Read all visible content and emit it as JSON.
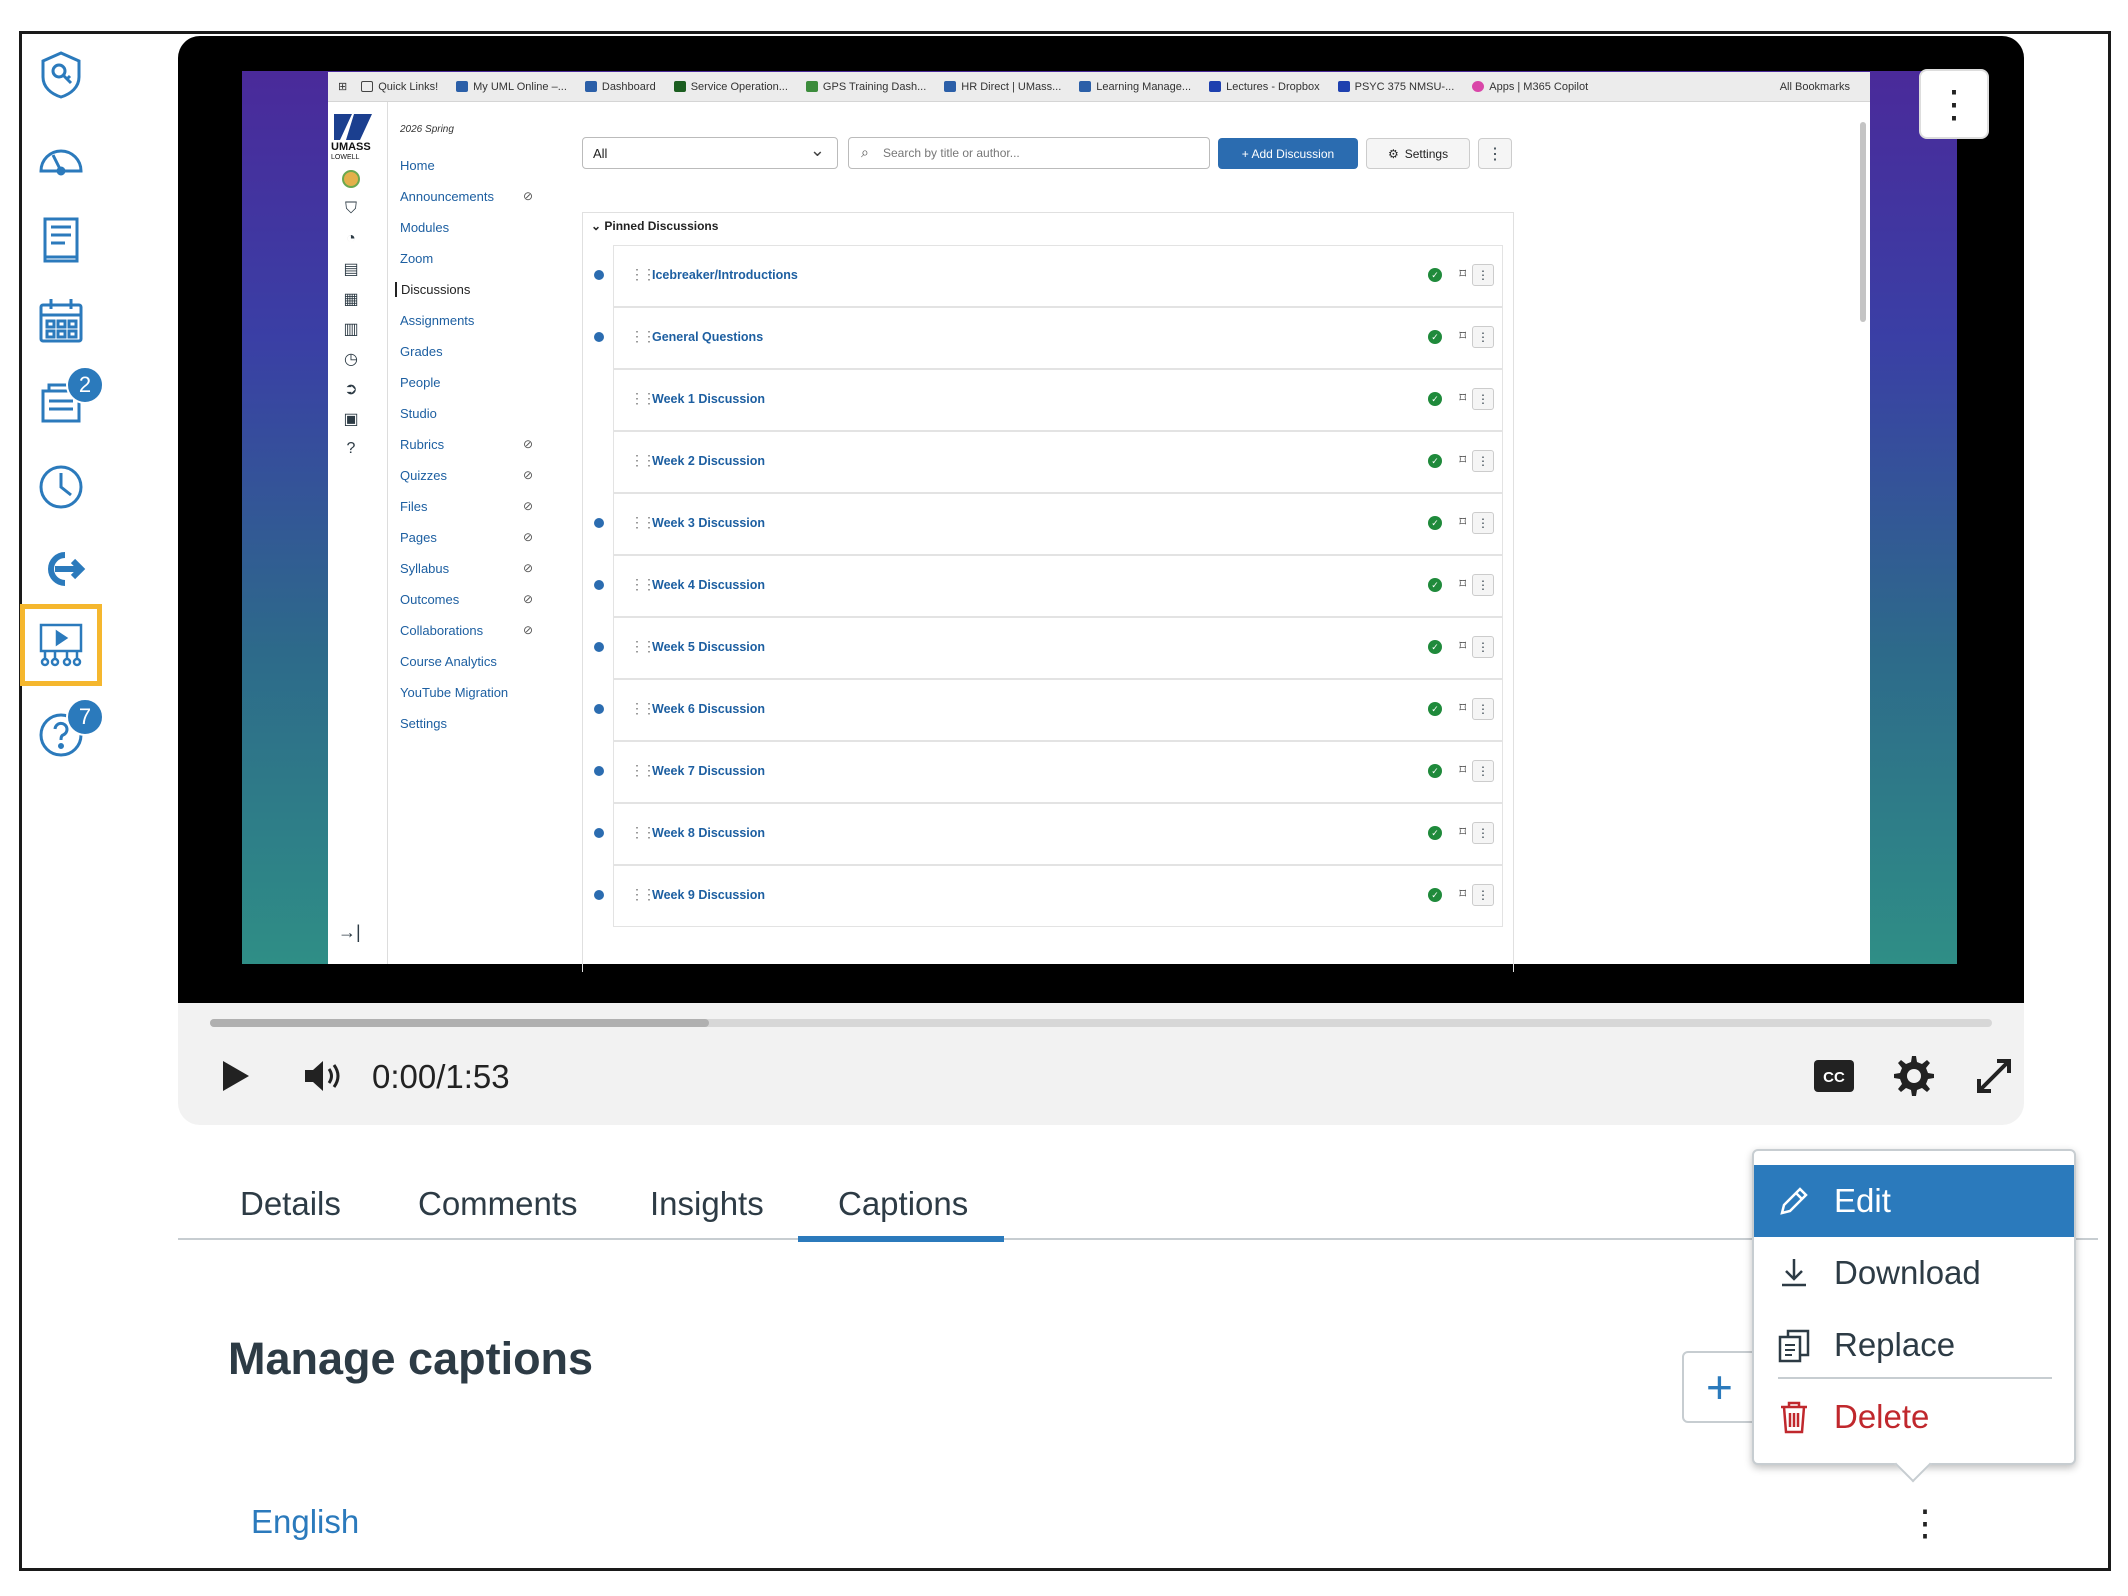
{
  "rail": {
    "badges": {
      "inbox": "2",
      "help": "7"
    }
  },
  "embedded": {
    "bookmarks": [
      "Quick Links!",
      "My UML Online –...",
      "Dashboard",
      "Service Operation...",
      "GPS Training Dash...",
      "HR Direct | UMass...",
      "Learning Manage...",
      "Lectures - Dropbox",
      "PSYC 375 NMSU-...",
      "Apps | M365 Copilot"
    ],
    "all_bookmarks": "All Bookmarks",
    "term": "2026 Spring",
    "course_nav": [
      "Home",
      "Announcements",
      "Modules",
      "Zoom",
      "Discussions",
      "Assignments",
      "Grades",
      "People",
      "Studio",
      "Rubrics",
      "Quizzes",
      "Files",
      "Pages",
      "Syllabus",
      "Outcomes",
      "Collaborations",
      "Course Analytics",
      "YouTube Migration",
      "Settings"
    ],
    "filter_value": "All",
    "search_placeholder": "Search by title or author...",
    "add_discussion": "+ Add Discussion",
    "settings": "Settings",
    "pinned_header": "Pinned Discussions",
    "discussions": [
      "Icebreaker/Introductions",
      "General Questions",
      "Week 1 Discussion",
      "Week 2 Discussion",
      "Week 3 Discussion",
      "Week 4 Discussion",
      "Week 5 Discussion",
      "Week 6 Discussion",
      "Week 7 Discussion",
      "Week 8 Discussion",
      "Week 9 Discussion"
    ]
  },
  "player": {
    "time": "0:00/1:53",
    "progress_buffered_fraction": 0.28,
    "cc_label": "CC"
  },
  "tabs": [
    "Details",
    "Comments",
    "Insights",
    "Captions"
  ],
  "active_tab": "Captions",
  "captions": {
    "title": "Manage captions",
    "add_symbol": "+",
    "language": "English"
  },
  "menu": {
    "edit": "Edit",
    "download": "Download",
    "replace": "Replace",
    "delete": "Delete"
  },
  "colors": {
    "accent": "#2b7abc",
    "active_outline": "#f5b72e",
    "danger": "#c0282d"
  }
}
